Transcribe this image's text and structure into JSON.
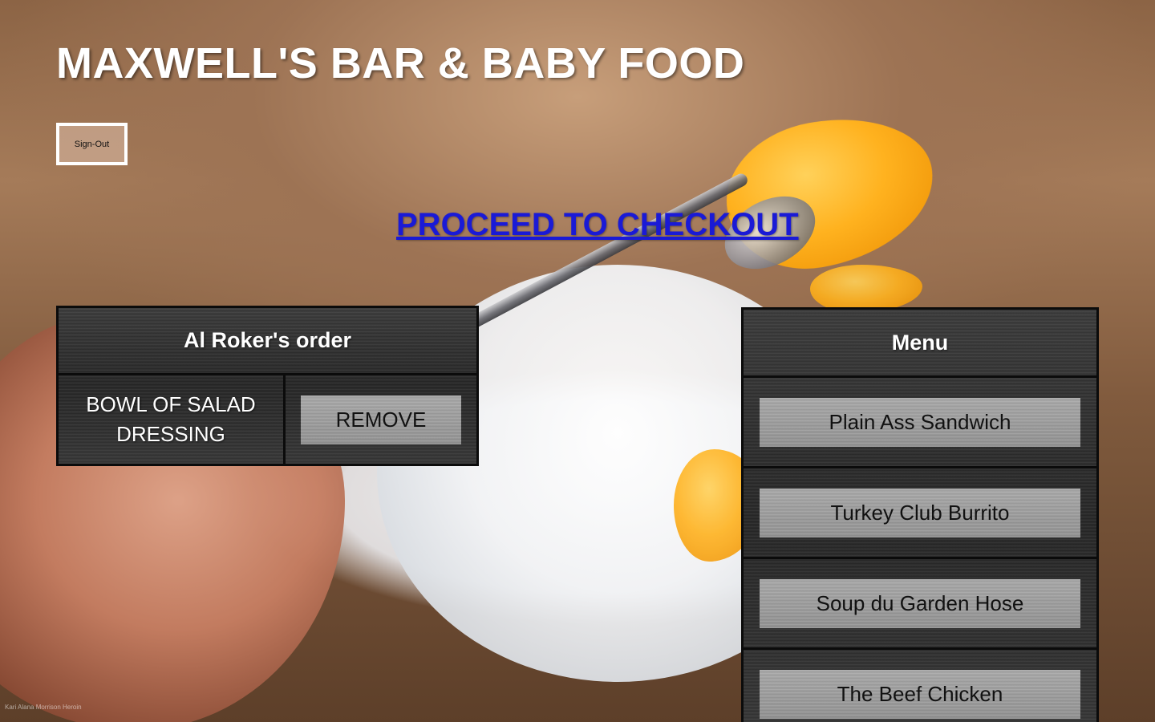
{
  "site": {
    "title": "MAXWELL'S BAR & BABY FOOD",
    "photo_credit": "Kari Alana Morrison Heroin"
  },
  "header": {
    "sign_out_label": "Sign-Out",
    "checkout_label": "PROCEED TO CHECKOUT"
  },
  "order": {
    "title": "Al Roker's order",
    "items": [
      {
        "name": "BOWL OF SALAD DRESSING",
        "action_label": "REMOVE"
      }
    ]
  },
  "menu": {
    "title": "Menu",
    "items": [
      {
        "label": "Plain Ass Sandwich"
      },
      {
        "label": "Turkey Club Burrito"
      },
      {
        "label": "Soup du Garden Hose"
      },
      {
        "label": "The Beef Chicken"
      }
    ]
  },
  "colors": {
    "link": "#1a1ad6",
    "panel_dark": "#2f2f2f",
    "button_gray": "#9b9b9b",
    "title_text": "#ffffff"
  }
}
